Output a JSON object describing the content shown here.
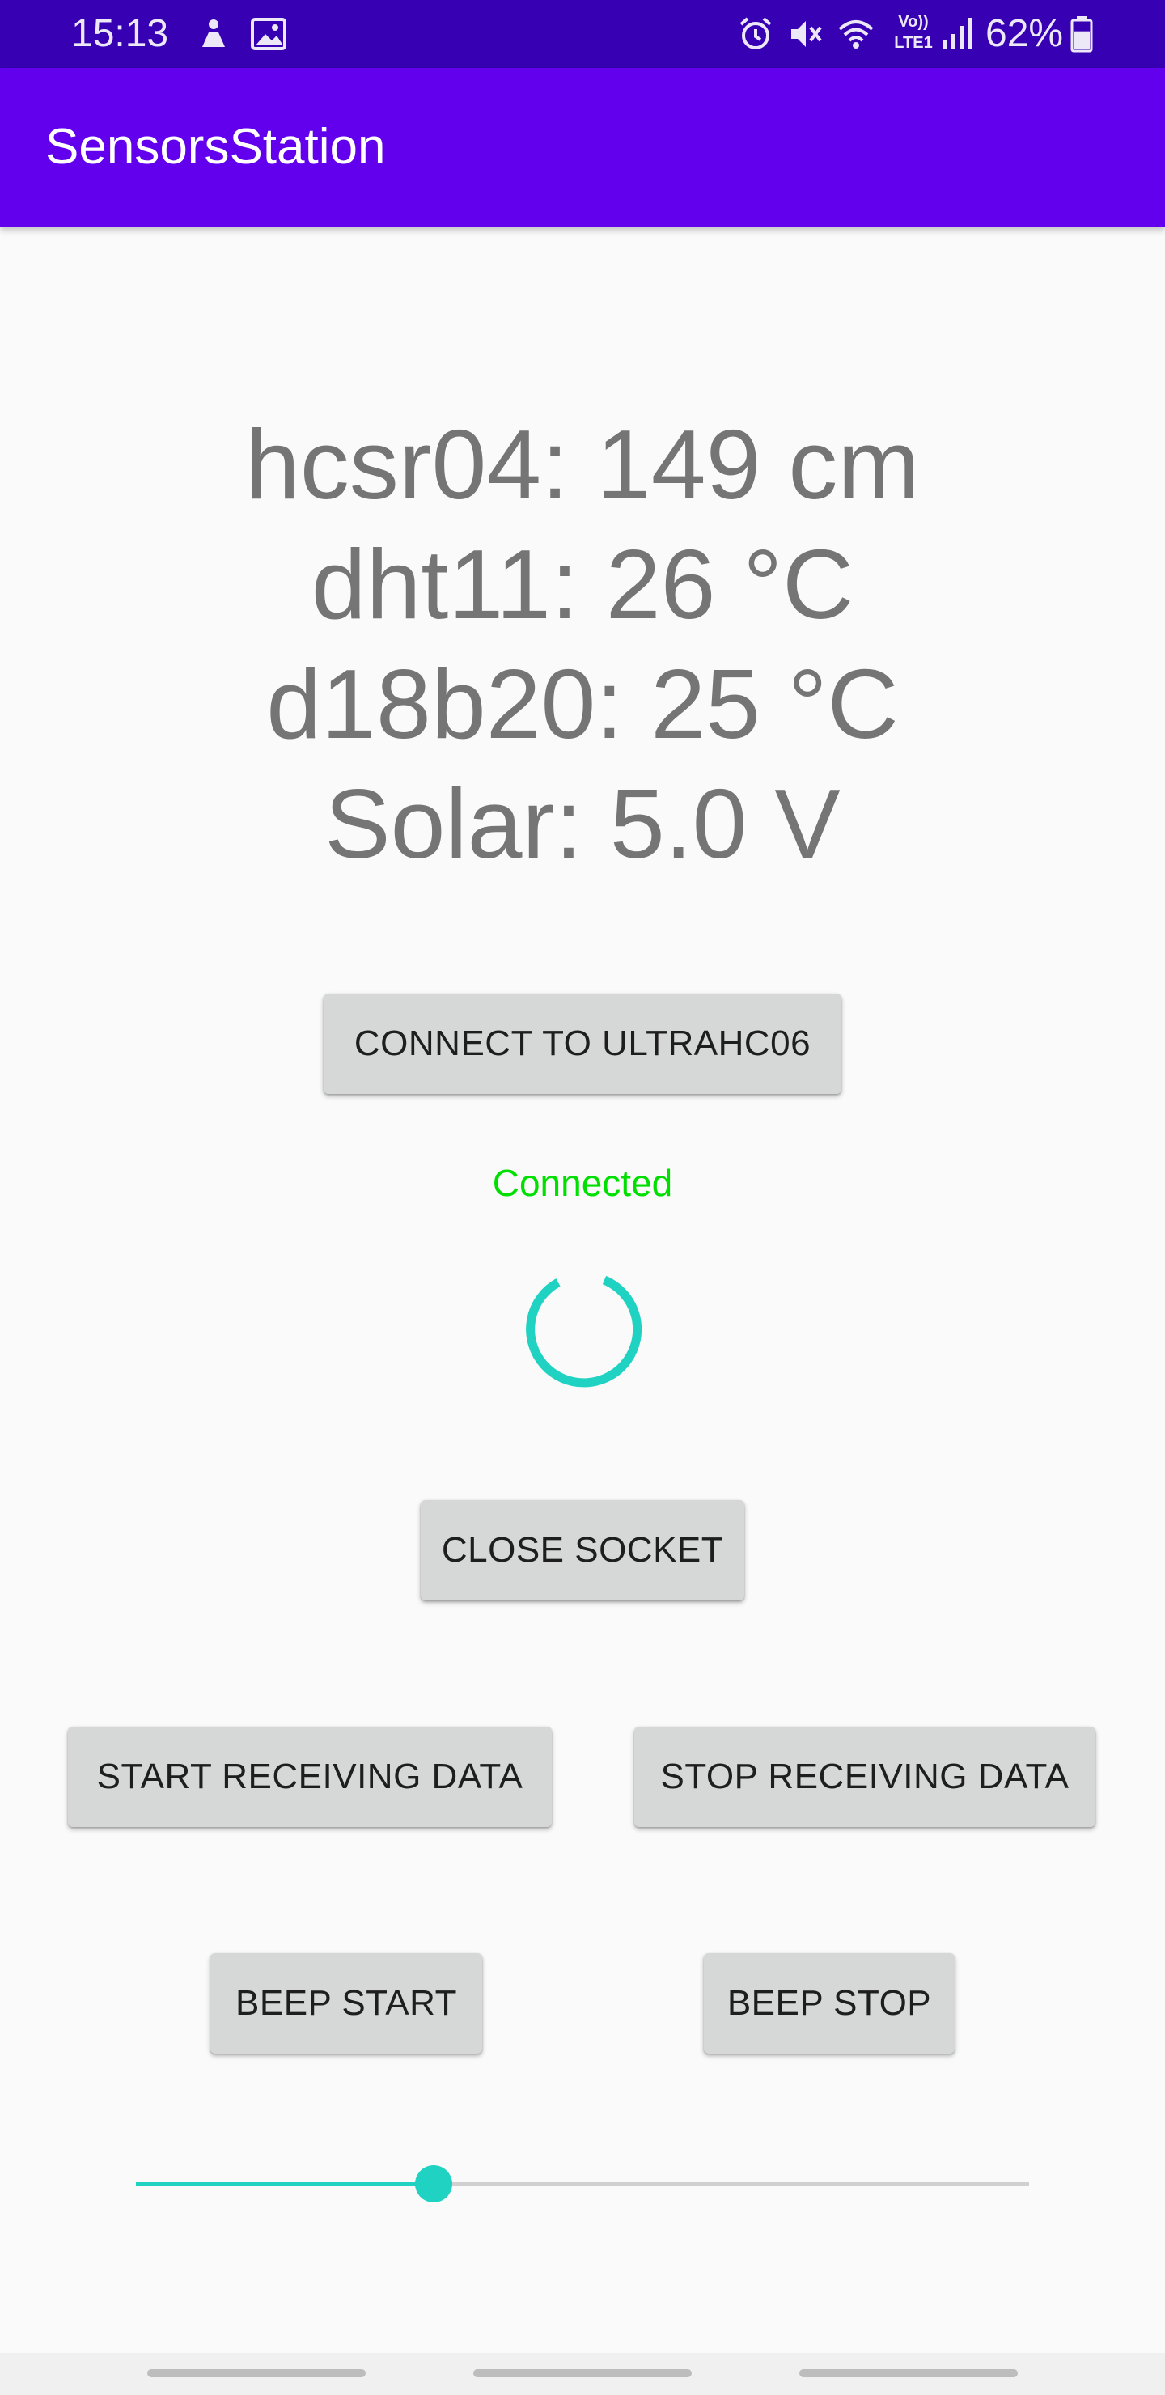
{
  "status_bar": {
    "time": "15:13",
    "left_icons": [
      "notification-icon",
      "image-icon"
    ],
    "right_icons": [
      "alarm-icon",
      "mute-icon",
      "wifi-icon",
      "volte-icon",
      "signal-icon"
    ],
    "volte_label": "Vo))",
    "lte_label": "LTE1",
    "battery_percent": "62%",
    "battery_level": 0.62,
    "background_color": "#3700b3"
  },
  "app_bar": {
    "title": "SensorsStation",
    "background_color": "#6200ee"
  },
  "readings": [
    {
      "label": "hcsr04:",
      "value": "149 cm"
    },
    {
      "label": "dht11:",
      "value": "26 °C"
    },
    {
      "label": "d18b20:",
      "value": "25 °C"
    },
    {
      "label": "Solar:",
      "value": "5.0 V"
    }
  ],
  "buttons": {
    "connect": "CONNECT TO ULTRAHC06",
    "close_socket": "CLOSE SOCKET",
    "start_receiving": "START RECEIVING DATA",
    "stop_receiving": "STOP RECEIVING DATA",
    "beep_start": "BEEP START",
    "beep_stop": "BEEP STOP"
  },
  "connection_status": {
    "text": "Connected",
    "color": "#00e000"
  },
  "spinner_color": "#20d2c2",
  "slider": {
    "value_fraction": 0.333,
    "color": "#20d2c2"
  }
}
